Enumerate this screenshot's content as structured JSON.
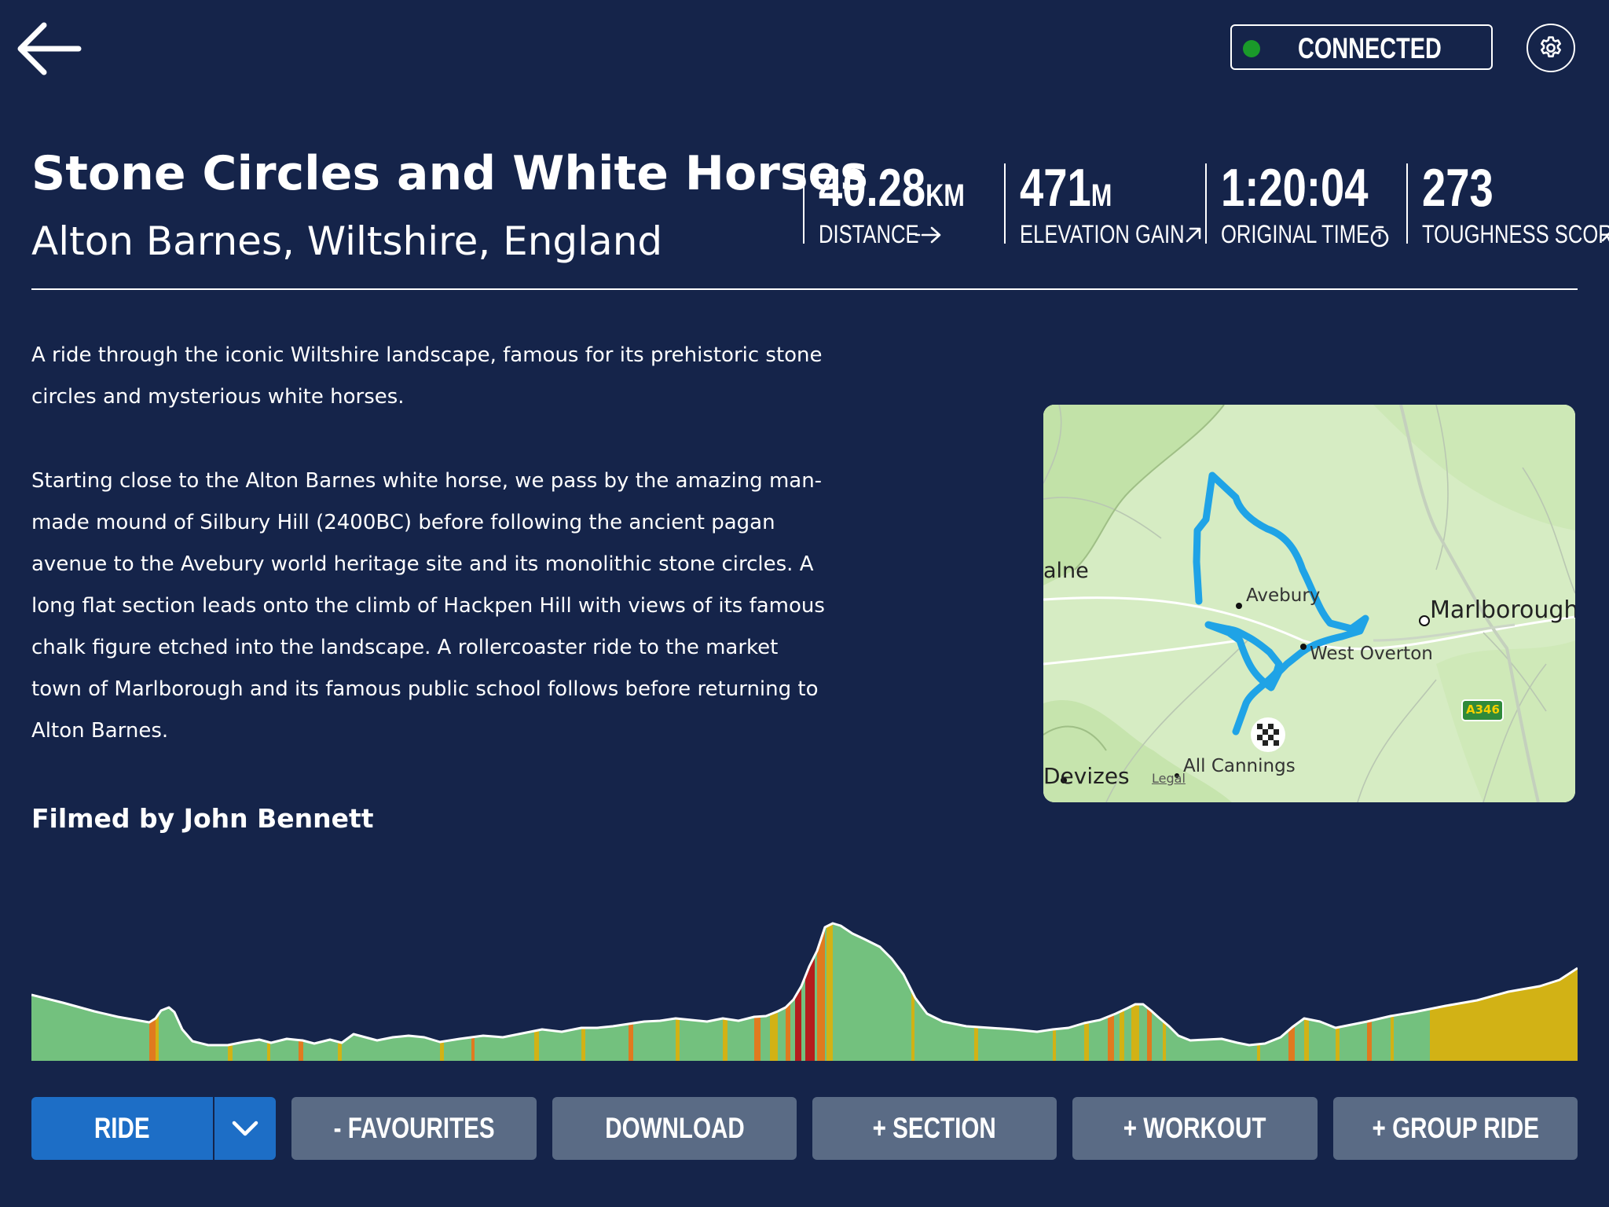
{
  "header": {
    "back_icon": "arrow-left-icon",
    "status": {
      "label": "CONNECTED",
      "dot_color": "#1a9a2a"
    },
    "settings_icon": "gear-icon"
  },
  "ride": {
    "title": "Stone Circles and White Horses",
    "location": "Alton Barnes, Wiltshire, England"
  },
  "stats": [
    {
      "value": "40.28",
      "unit": "KM",
      "label": "DISTANCE",
      "icon": "arrow-right-dashed-icon"
    },
    {
      "value": "471",
      "unit": "M",
      "label": "ELEVATION GAIN",
      "icon": "arrow-up-right-icon"
    },
    {
      "value": "1:20:04",
      "unit": "",
      "label": "ORIGINAL TIME",
      "icon": "stopwatch-icon"
    },
    {
      "value": "273",
      "unit": "",
      "label": "TOUGHNESS SCORE",
      "icon": "arrow-up-right-icon"
    }
  ],
  "description": {
    "paragraphs": [
      "A ride through the iconic Wiltshire landscape, famous for its prehistoric stone circles and mysterious white horses.",
      "Starting close to the Alton Barnes white horse, we pass by the amazing man-made mound of Silbury Hill (2400BC) before following the ancient pagan avenue to the Avebury world heritage site and its monolithic stone circles.  A long flat section leads onto the climb of Hackpen Hill with views of its famous chalk figure etched into the landscape.  A rollercoaster ride to the market town of Marlborough and its famous public school follows before returning to Alton Barnes."
    ]
  },
  "filmed_by": "Filmed by John Bennett",
  "map": {
    "labels": {
      "calne": "alne",
      "avebury": "Avebury",
      "marlborough": "Marlborough",
      "west_overton": "West Overton",
      "devizes": "Devizes",
      "all_cannings": "All Cannings",
      "legal": "Legal",
      "road": "A346"
    },
    "route_color": "#1fa3e6",
    "finish_icon": "checkered-flag-icon"
  },
  "actions": {
    "ride": "RIDE",
    "ride_dropdown_icon": "chevron-down-icon",
    "favourites": "- FAVOURITES",
    "download": "DOWNLOAD",
    "section": "+ SECTION",
    "workout": "+ WORKOUT",
    "group_ride": "+ GROUP RIDE"
  },
  "colors": {
    "background": "#15244a",
    "primary_button": "#1d6ec6",
    "secondary_button": "#5a6b85",
    "profile_green": "#73c17e",
    "profile_yellow": "#d2b215",
    "profile_orange": "#e07a1f",
    "profile_red": "#b51d1d"
  }
}
